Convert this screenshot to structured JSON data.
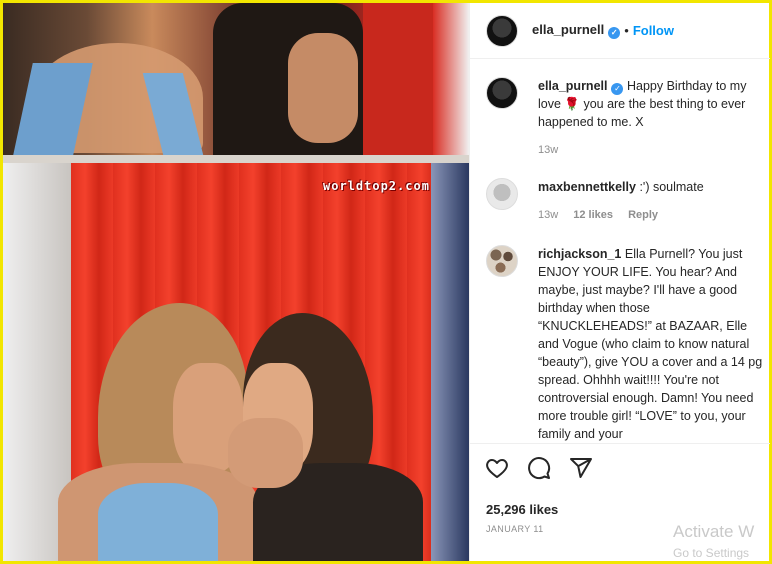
{
  "watermark": "worldtop2.com",
  "post": {
    "username": "ella_purnell",
    "follow_label": "Follow",
    "separator": "•",
    "caption": {
      "username": "ella_purnell",
      "text": "Happy Birthday to my love 🌹 you are the best thing to ever happened to me. X",
      "age": "13w"
    }
  },
  "comments": [
    {
      "username": "maxbennettkelly",
      "text": ":') soulmate",
      "age": "13w",
      "likes": "12 likes",
      "reply_label": "Reply"
    },
    {
      "username": "richjackson_1",
      "text": "Ella Purnell? You just ENJOY YOUR LIFE. You hear? And maybe, just maybe? I'll have a good birthday when those “KNUCKLEHEADS!” at BAZAAR, Elle and Vogue (who claim to know natural “beauty”), give YOU a cover and a 14 pg spread. Ohhhh wait!!!! You're not controversial enough. Damn! You need more trouble girl! “LOVE” to you, your family and your"
    }
  ],
  "actions": {
    "icons": [
      "heart-icon",
      "comment-icon",
      "share-icon"
    ],
    "likes": "25,296 likes",
    "date": "JANUARY 11"
  },
  "system": {
    "activate_title": "Activate W",
    "activate_sub": "Go to Settings"
  },
  "colors": {
    "accent": "#0095f6",
    "verified": "#3897f0",
    "frame": "#f2e600"
  }
}
